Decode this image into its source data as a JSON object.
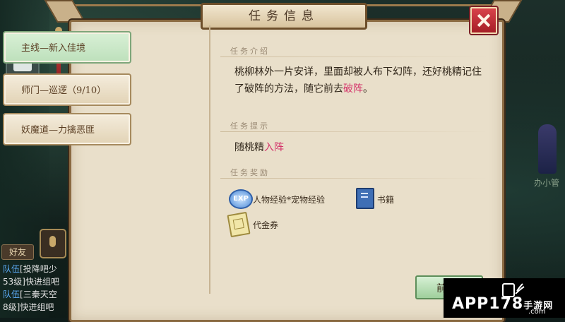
{
  "dialog": {
    "title": "任务信息"
  },
  "tabs": [
    {
      "label": "主线—新入佳境",
      "active": true
    },
    {
      "label": "师门—巡逻（9/10）",
      "active": false
    },
    {
      "label": "妖魔道—力擒恶匪",
      "active": false
    }
  ],
  "intro": {
    "heading": "任务介绍",
    "text_before": "桃柳林外一片安详，里面却被人布下幻阵，还好桃精记住了破阵的方法，随它前去",
    "highlight": "破阵",
    "text_after": "。"
  },
  "hint": {
    "heading": "任务提示",
    "text_before": "随桃精",
    "highlight": "入阵"
  },
  "rewards": {
    "heading": "任务奖励",
    "items": [
      {
        "icon": "exp-icon",
        "icon_text": "EXP",
        "label": "人物经验*宠物经验"
      },
      {
        "icon": "book-icon",
        "label": "书籍"
      },
      {
        "icon": "ticket-icon",
        "label": "代金券"
      }
    ]
  },
  "go_button": {
    "label": "前"
  },
  "sidebar": {
    "friend_label": "好友"
  },
  "chat": [
    {
      "tag": "队伍",
      "text": "[投降吧少"
    },
    {
      "tag": "",
      "text": "53级]快进组吧"
    },
    {
      "tag": "队伍",
      "text": "[三秦天空"
    },
    {
      "tag": "",
      "text": "8级]快进组吧"
    }
  ],
  "scene": {
    "npc_label": "办小管"
  },
  "watermark": {
    "brand": "APP178",
    "suffix": "手游网",
    "sub": ".com"
  },
  "colors": {
    "highlight": "#d4356b",
    "active_tab": "#bde0bb",
    "close": "#b8242c"
  }
}
